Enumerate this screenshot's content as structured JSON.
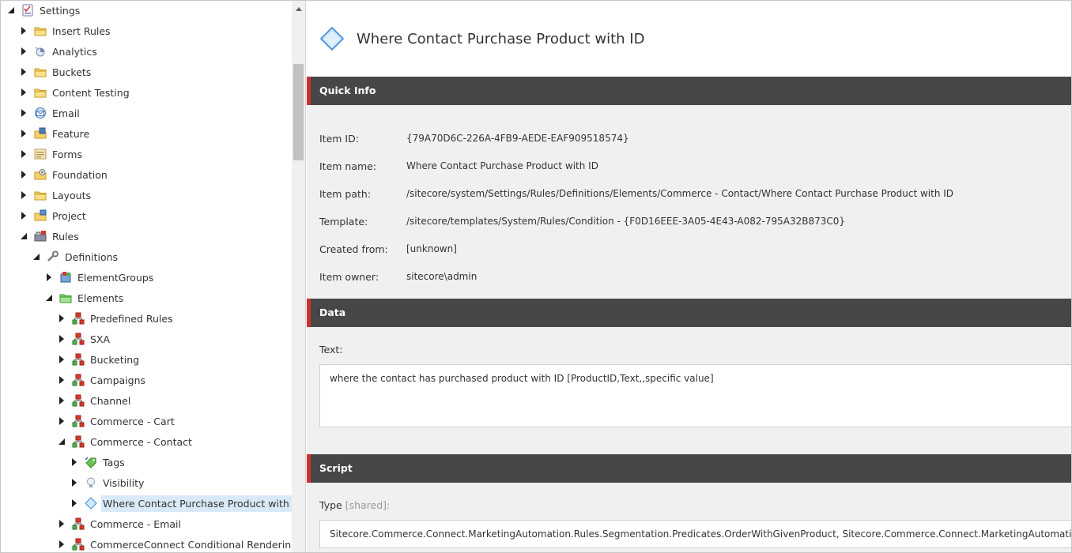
{
  "tree": {
    "items": [
      {
        "label": "Settings",
        "icon": "settings-icon",
        "state": "expanded",
        "selected": false
      },
      {
        "label": "Insert Rules",
        "icon": "folder-icon",
        "state": "collapsed",
        "selected": false
      },
      {
        "label": "Analytics",
        "icon": "analytics-icon",
        "state": "collapsed",
        "selected": false
      },
      {
        "label": "Buckets",
        "icon": "folder-icon",
        "state": "collapsed",
        "selected": false
      },
      {
        "label": "Content Testing",
        "icon": "folder-icon",
        "state": "collapsed",
        "selected": false
      },
      {
        "label": "Email",
        "icon": "email-icon",
        "state": "collapsed",
        "selected": false
      },
      {
        "label": "Feature",
        "icon": "feature-icon",
        "state": "collapsed",
        "selected": false
      },
      {
        "label": "Forms",
        "icon": "forms-icon",
        "state": "collapsed",
        "selected": false
      },
      {
        "label": "Foundation",
        "icon": "foundation-icon",
        "state": "collapsed",
        "selected": false
      },
      {
        "label": "Layouts",
        "icon": "folder-icon",
        "state": "collapsed",
        "selected": false
      },
      {
        "label": "Project",
        "icon": "project-icon",
        "state": "collapsed",
        "selected": false
      },
      {
        "label": "Rules",
        "icon": "rules-icon",
        "state": "expanded",
        "selected": false
      },
      {
        "label": "Definitions",
        "icon": "wrench-icon",
        "state": "expanded",
        "selected": false
      },
      {
        "label": "ElementGroups",
        "icon": "element-groups-icon",
        "state": "collapsed",
        "selected": false
      },
      {
        "label": "Elements",
        "icon": "elements-folder-icon",
        "state": "expanded",
        "selected": false
      },
      {
        "label": "Predefined Rules",
        "icon": "hierarchy-icon",
        "state": "collapsed",
        "selected": false
      },
      {
        "label": "SXA",
        "icon": "hierarchy-icon",
        "state": "collapsed",
        "selected": false
      },
      {
        "label": "Bucketing",
        "icon": "hierarchy-icon",
        "state": "collapsed",
        "selected": false
      },
      {
        "label": "Campaigns",
        "icon": "hierarchy-icon",
        "state": "collapsed",
        "selected": false
      },
      {
        "label": "Channel",
        "icon": "hierarchy-icon",
        "state": "collapsed",
        "selected": false
      },
      {
        "label": "Commerce - Cart",
        "icon": "hierarchy-icon",
        "state": "collapsed",
        "selected": false
      },
      {
        "label": "Commerce - Contact",
        "icon": "hierarchy-icon",
        "state": "expanded",
        "selected": false
      },
      {
        "label": "Tags",
        "icon": "tags-icon",
        "state": "collapsed",
        "selected": false
      },
      {
        "label": "Visibility",
        "icon": "lightbulb-icon",
        "state": "collapsed",
        "selected": false
      },
      {
        "label": "Where Contact Purchase Product with ID",
        "icon": "diamond-icon",
        "state": "collapsed",
        "selected": true
      },
      {
        "label": "Commerce - Email",
        "icon": "hierarchy-icon",
        "state": "collapsed",
        "selected": false
      },
      {
        "label": "CommerceConnect Conditional Renderings",
        "icon": "hierarchy-icon",
        "state": "collapsed",
        "selected": false
      }
    ]
  },
  "header": {
    "title": "Where Contact Purchase Product with ID",
    "icon": "diamond-icon"
  },
  "quick_info": {
    "title": "Quick Info",
    "rows": [
      {
        "label": "Item ID:",
        "value": "{79A70D6C-226A-4FB9-AEDE-EAF909518574}"
      },
      {
        "label": "Item name:",
        "value": "Where Contact Purchase Product with ID"
      },
      {
        "label": "Item path:",
        "value": "/sitecore/system/Settings/Rules/Definitions/Elements/Commerce - Contact/Where Contact Purchase Product with ID"
      },
      {
        "label": "Template:",
        "value": "/sitecore/templates/System/Rules/Condition - {F0D16EEE-3A05-4E43-A082-795A32B873C0}"
      },
      {
        "label": "Created from:",
        "value": "[unknown]"
      },
      {
        "label": "Item owner:",
        "value": "sitecore\\admin"
      }
    ]
  },
  "data_section": {
    "title": "Data",
    "text_label": "Text:",
    "text_value": "where the contact has purchased product with ID [ProductID,Text,,specific value]"
  },
  "script_section": {
    "title": "Script",
    "type_label": "Type",
    "shared_label": "[shared]:",
    "type_value": "Sitecore.Commerce.Connect.MarketingAutomation.Rules.Segmentation.Predicates.OrderWithGivenProduct, Sitecore.Commerce.Connect.MarketingAutomation.Rules"
  },
  "colors": {
    "section_bar": "#474747",
    "section_accent": "#d32f2f",
    "selected_bg": "#d9e9f7",
    "content_bg": "#f0f0f0"
  }
}
